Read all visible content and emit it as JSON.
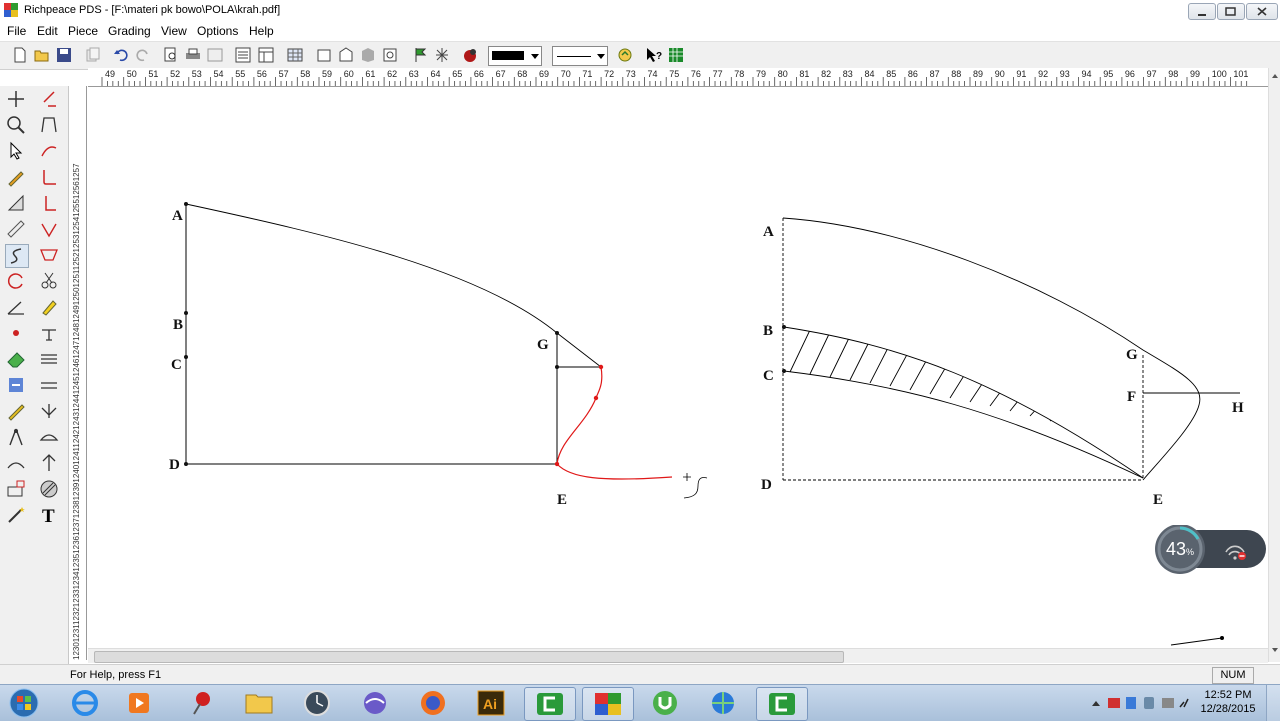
{
  "window": {
    "title": "Richpeace PDS - [F:\\materi pk bowo\\POLA\\krah.pdf]"
  },
  "menu": {
    "items": [
      "File",
      "Edit",
      "Piece",
      "Grading",
      "View",
      "Options",
      "Help"
    ]
  },
  "ruler": {
    "h_labels": [
      "49",
      "50",
      "51",
      "52",
      "53",
      "54",
      "55",
      "56",
      "57",
      "58",
      "59",
      "60",
      "61",
      "62",
      "63",
      "64",
      "65",
      "66",
      "67",
      "68",
      "69",
      "70",
      "71",
      "72",
      "73",
      "74",
      "75",
      "76",
      "77",
      "78",
      "79",
      "80",
      "81",
      "82",
      "83",
      "84",
      "85",
      "86",
      "87",
      "88",
      "89",
      "90",
      "91",
      "92",
      "93",
      "94",
      "95",
      "96",
      "97",
      "98",
      "99",
      "100",
      "101"
    ],
    "v_labels": "1230123112321233123412351236123712381239124012411242124312441245124612471248124912501251125212531254125512561257"
  },
  "drawing": {
    "left_piece_labels": [
      "A",
      "B",
      "C",
      "D",
      "G",
      "E"
    ],
    "right_piece_labels": [
      "A",
      "B",
      "C",
      "D",
      "G",
      "F",
      "H",
      "E"
    ]
  },
  "status": {
    "help": "For Help, press F1",
    "num": "NUM"
  },
  "widget": {
    "percent": "43",
    "unit": "%"
  },
  "clock": {
    "time": "12:52 PM",
    "date": "12/28/2015"
  },
  "colors": {
    "pattern_line": "#000000",
    "edit_curve": "#e01818",
    "taskbar": "#b9cde4"
  }
}
